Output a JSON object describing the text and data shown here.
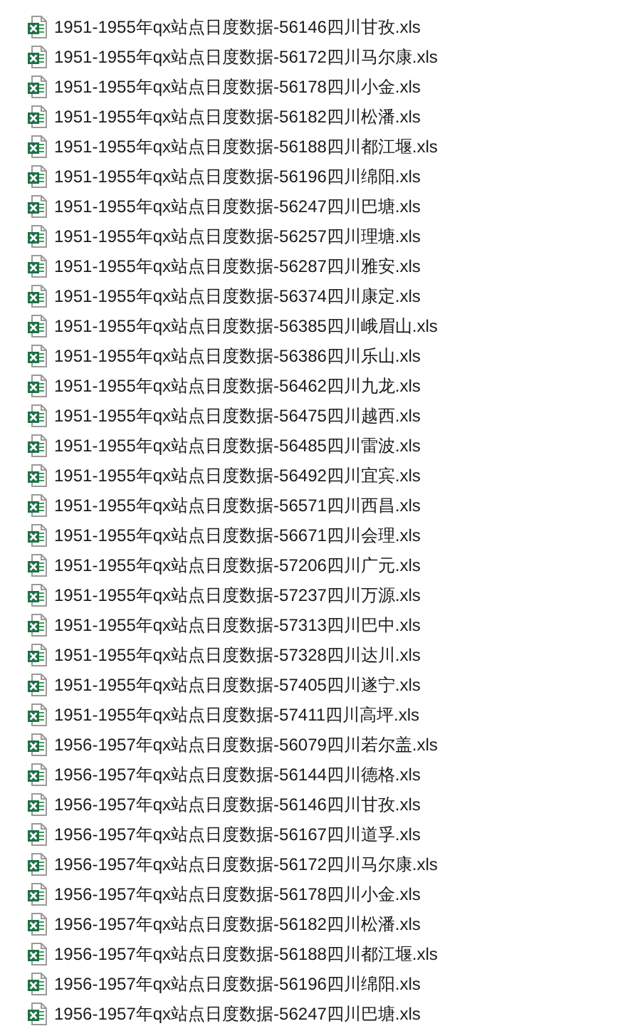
{
  "files": [
    {
      "name": "1951-1955年qx站点日度数据-56146四川甘孜.xls"
    },
    {
      "name": "1951-1955年qx站点日度数据-56172四川马尔康.xls"
    },
    {
      "name": "1951-1955年qx站点日度数据-56178四川小金.xls"
    },
    {
      "name": "1951-1955年qx站点日度数据-56182四川松潘.xls"
    },
    {
      "name": "1951-1955年qx站点日度数据-56188四川都江堰.xls"
    },
    {
      "name": "1951-1955年qx站点日度数据-56196四川绵阳.xls"
    },
    {
      "name": "1951-1955年qx站点日度数据-56247四川巴塘.xls"
    },
    {
      "name": "1951-1955年qx站点日度数据-56257四川理塘.xls"
    },
    {
      "name": "1951-1955年qx站点日度数据-56287四川雅安.xls"
    },
    {
      "name": "1951-1955年qx站点日度数据-56374四川康定.xls"
    },
    {
      "name": "1951-1955年qx站点日度数据-56385四川峨眉山.xls"
    },
    {
      "name": "1951-1955年qx站点日度数据-56386四川乐山.xls"
    },
    {
      "name": "1951-1955年qx站点日度数据-56462四川九龙.xls"
    },
    {
      "name": "1951-1955年qx站点日度数据-56475四川越西.xls"
    },
    {
      "name": "1951-1955年qx站点日度数据-56485四川雷波.xls"
    },
    {
      "name": "1951-1955年qx站点日度数据-56492四川宜宾.xls"
    },
    {
      "name": "1951-1955年qx站点日度数据-56571四川西昌.xls"
    },
    {
      "name": "1951-1955年qx站点日度数据-56671四川会理.xls"
    },
    {
      "name": "1951-1955年qx站点日度数据-57206四川广元.xls"
    },
    {
      "name": "1951-1955年qx站点日度数据-57237四川万源.xls"
    },
    {
      "name": "1951-1955年qx站点日度数据-57313四川巴中.xls"
    },
    {
      "name": "1951-1955年qx站点日度数据-57328四川达川.xls"
    },
    {
      "name": "1951-1955年qx站点日度数据-57405四川遂宁.xls"
    },
    {
      "name": "1951-1955年qx站点日度数据-57411四川高坪.xls"
    },
    {
      "name": "1956-1957年qx站点日度数据-56079四川若尔盖.xls"
    },
    {
      "name": "1956-1957年qx站点日度数据-56144四川德格.xls"
    },
    {
      "name": "1956-1957年qx站点日度数据-56146四川甘孜.xls"
    },
    {
      "name": "1956-1957年qx站点日度数据-56167四川道孚.xls"
    },
    {
      "name": "1956-1957年qx站点日度数据-56172四川马尔康.xls"
    },
    {
      "name": "1956-1957年qx站点日度数据-56178四川小金.xls"
    },
    {
      "name": "1956-1957年qx站点日度数据-56182四川松潘.xls"
    },
    {
      "name": "1956-1957年qx站点日度数据-56188四川都江堰.xls"
    },
    {
      "name": "1956-1957年qx站点日度数据-56196四川绵阳.xls"
    },
    {
      "name": "1956-1957年qx站点日度数据-56247四川巴塘.xls"
    }
  ]
}
